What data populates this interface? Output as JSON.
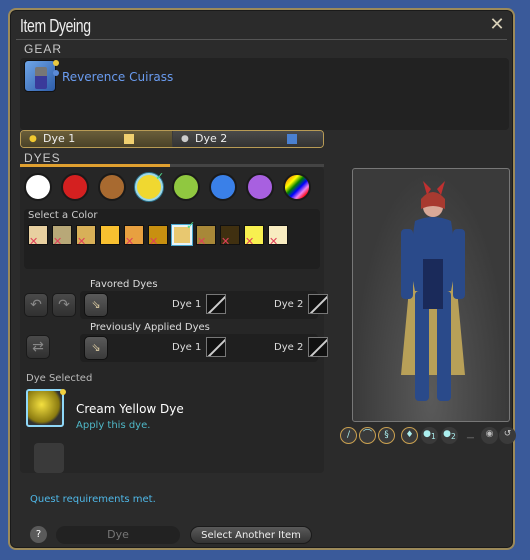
{
  "window": {
    "title": "Item Dyeing",
    "close_icon": "close-icon"
  },
  "gear": {
    "section_label": "GEAR",
    "item_name": "Reverence Cuirass",
    "slot_dots": [
      "#e8c840",
      "#5a8ad8"
    ]
  },
  "dye_tabs": [
    {
      "label": "Dye 1",
      "icon": "dye-drop-icon",
      "swatch": "#f0d070",
      "active": true
    },
    {
      "label": "Dye 2",
      "icon": "dye-drop-icon",
      "swatch": "#4a80d0",
      "active": false
    }
  ],
  "dyes": {
    "section_label": "DYES",
    "categories": [
      {
        "name": "white",
        "color": "#ffffff"
      },
      {
        "name": "red",
        "color": "#d42020"
      },
      {
        "name": "brown",
        "color": "#a86a30"
      },
      {
        "name": "yellow",
        "color": "#f0d830",
        "selected": true
      },
      {
        "name": "green",
        "color": "#90c840"
      },
      {
        "name": "blue",
        "color": "#3a80e8"
      },
      {
        "name": "purple",
        "color": "#a860e0"
      },
      {
        "name": "special",
        "color": "rainbow"
      }
    ],
    "select_label": "Select a Color",
    "swatches": [
      {
        "color": "#e8d0a0",
        "unavailable": true
      },
      {
        "color": "#b8a878",
        "unavailable": true
      },
      {
        "color": "#d8b058",
        "unavailable": true
      },
      {
        "color": "#f8c030",
        "unavailable": false
      },
      {
        "color": "#e8a040",
        "unavailable": true
      },
      {
        "color": "#c89010",
        "unavailable": true
      },
      {
        "color": "#e8c870",
        "unavailable": false,
        "selected": true
      },
      {
        "color": "#a88838",
        "unavailable": true
      },
      {
        "color": "#403010",
        "unavailable": true
      },
      {
        "color": "#f8f050",
        "unavailable": true
      },
      {
        "color": "#f8ecc0",
        "unavailable": true
      }
    ]
  },
  "favored": {
    "label": "Favored Dyes",
    "dye1_label": "Dye 1",
    "dye2_label": "Dye 2"
  },
  "previous": {
    "label": "Previously Applied Dyes",
    "dye1_label": "Dye 1",
    "dye2_label": "Dye 2"
  },
  "selected": {
    "label": "Dye Selected",
    "name": "Cream Yellow Dye",
    "hint": "Apply this dye."
  },
  "footer": {
    "quest_status": "Quest requirements met.",
    "help_label": "?",
    "dye_button": "Dye",
    "select_another_button": "Select Another Item"
  },
  "preview_toolbar": {
    "toggles": [
      "weapon-icon",
      "headgear-icon",
      "visor-icon",
      "dye-preview-icon",
      "dye1-icon",
      "dye2-icon",
      "hide-gear-icon",
      "view-icon",
      "reset-icon"
    ],
    "dye1_sub": "1",
    "dye2_sub": "2"
  }
}
